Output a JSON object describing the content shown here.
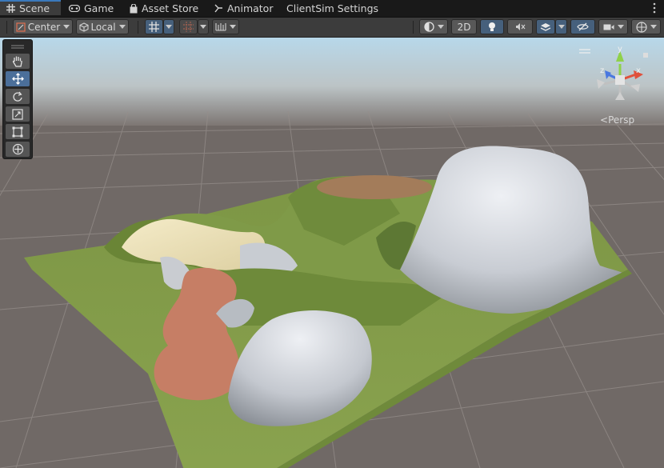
{
  "tabs": [
    {
      "label": "Scene",
      "icon": "grid-icon",
      "active": true
    },
    {
      "label": "Game",
      "icon": "gamepad-icon",
      "active": false
    },
    {
      "label": "Asset Store",
      "icon": "bag-icon",
      "active": false
    },
    {
      "label": "Animator",
      "icon": "animator-icon",
      "active": false
    },
    {
      "label": "ClientSim Settings",
      "icon": "",
      "active": false
    }
  ],
  "toolbar": {
    "pivot_mode": "Center",
    "pivot_rotation": "Local",
    "mode_2d": "2D"
  },
  "viewport": {
    "projection": "Persp",
    "gizmo_axes": [
      "y",
      "x",
      "z"
    ]
  },
  "tools": [
    "hand-tool",
    "move-tool",
    "rotate-tool",
    "scale-tool",
    "rect-tool",
    "transform-tool"
  ],
  "colors": {
    "accent": "#3a79bb",
    "active_button": "#46607c",
    "grass": "#7f9a48",
    "ground": "#6f6763",
    "x_axis": "#e0503c",
    "y_axis": "#8fd14a",
    "z_axis": "#4a78e0"
  }
}
